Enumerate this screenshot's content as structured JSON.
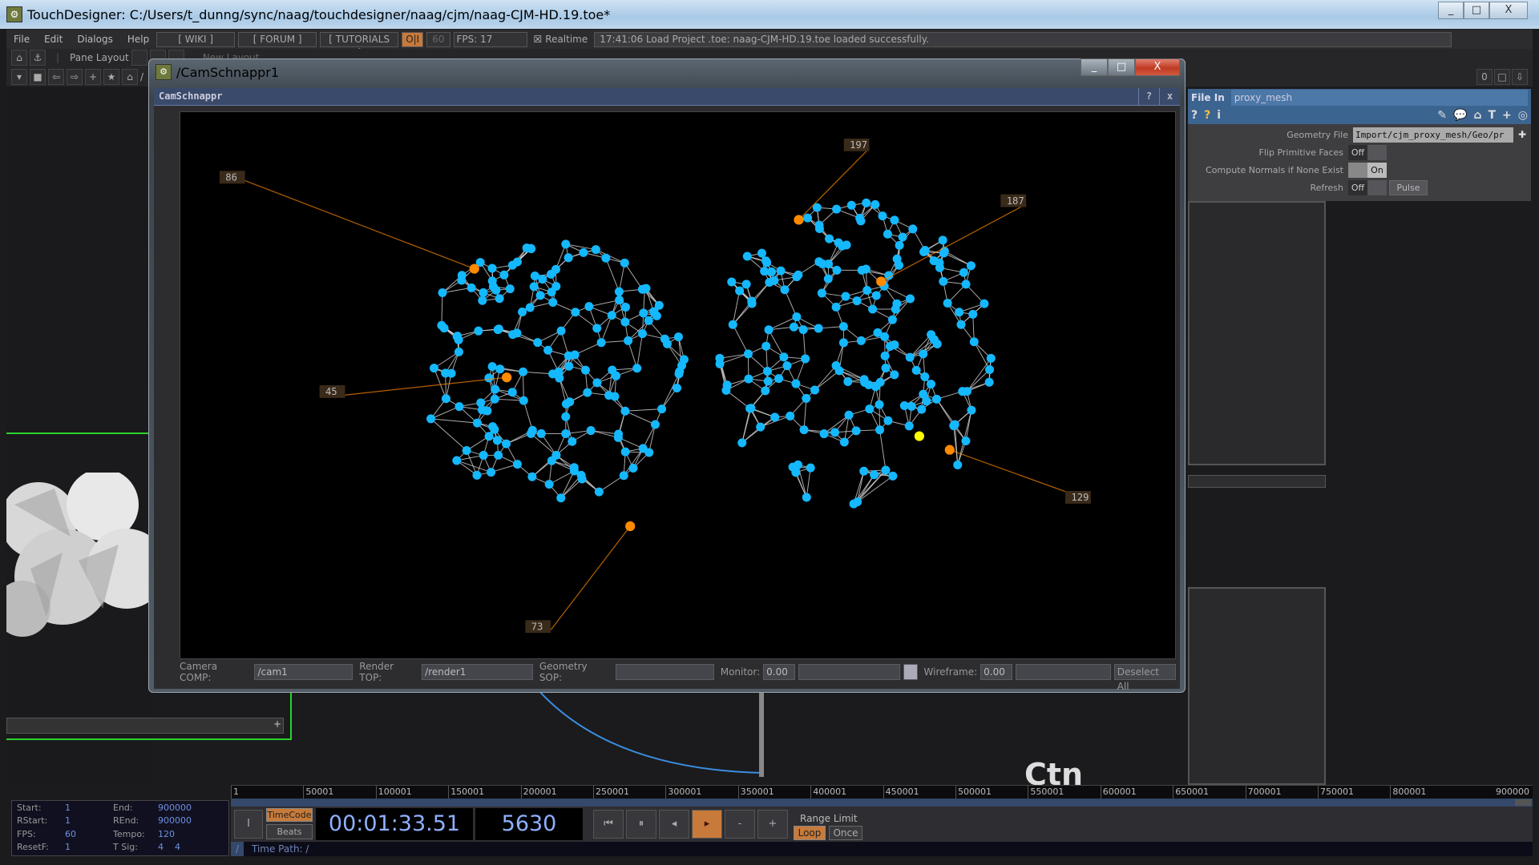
{
  "app": {
    "title": "TouchDesigner: C:/Users/t_dunng/sync/naag/touchdesigner/naag/cjm/naag-CJM-HD.19.toe*"
  },
  "menu": {
    "items": [
      "File",
      "Edit",
      "Dialogs",
      "Help"
    ],
    "wiki": "[ WIKI ]",
    "forum": "[ FORUM ]",
    "tutorials": "[ TUTORIALS ]",
    "oi": "O|I",
    "fps_cap": "60",
    "fps": "FPS:  17",
    "realtime": "Realtime",
    "message": "17:41:06 Load Project .toe: naag-CJM-HD.19.toe loaded successfully."
  },
  "toolbar": {
    "pane_layout": "Pane Layout",
    "new_layout": "New Layout",
    "path_sep": "/"
  },
  "floating": {
    "title": "/CamSchnappr1",
    "header": "CamSchnappr",
    "help": "?",
    "close": "x",
    "fields": {
      "camera_label": "Camera COMP:",
      "camera_value": "/cam1",
      "render_label": "Render TOP:",
      "render_value": "/render1",
      "geometry_label": "Geometry SOP:",
      "geometry_value": "",
      "monitor_label": "Monitor:",
      "monitor_value": "0.00",
      "wireframe_label": "Wireframe:",
      "wireframe_value": "0.00",
      "deselect": "Deselect All"
    },
    "markers": [
      "86",
      "197",
      "187",
      "45",
      "129",
      "73"
    ],
    "colors": {
      "vertex": "#14b8ff",
      "selected": "#ff8a00",
      "active": "#ffff00",
      "edge": "#d8d8d8"
    }
  },
  "params": {
    "op_type": "File In",
    "op_name": "proxy_mesh",
    "rows": [
      {
        "label": "Geometry File",
        "value": "Import/cjm_proxy_mesh/Geo/pr"
      },
      {
        "label": "Flip Primitive Faces",
        "value": "Off"
      },
      {
        "label": "Compute Normals if None Exist",
        "value": "On"
      },
      {
        "label": "Refresh",
        "value": "Off",
        "button": "Pulse"
      }
    ]
  },
  "network": {
    "overlay_text": "Ctn"
  },
  "timeline": {
    "ticks": [
      "1",
      "50001",
      "100001",
      "150001",
      "200001",
      "250001",
      "300001",
      "350001",
      "400001",
      "450001",
      "500001",
      "550001",
      "600001",
      "650001",
      "700001",
      "750001",
      "800001",
      "900000"
    ]
  },
  "transport": {
    "timecode_btn": "TimeCode",
    "beats_btn": "Beats",
    "timecode": "00:01:33.51",
    "frame": "5630",
    "range_limit": "Range Limit",
    "loop": "Loop",
    "once": "Once",
    "time_path": "Time Path: /",
    "path_btn": "/"
  },
  "info": {
    "start_l": "Start:",
    "start": "1",
    "end_l": "End:",
    "end": "900000",
    "rstart_l": "RStart:",
    "rstart": "1",
    "rend_l": "REnd:",
    "rend": "900000",
    "fps_l": "FPS:",
    "fps": "60",
    "tempo_l": "Tempo:",
    "tempo": "120",
    "resetf_l": "ResetF:",
    "resetf": "1",
    "tsig_l": "T Sig:",
    "tsig": "4    4"
  }
}
